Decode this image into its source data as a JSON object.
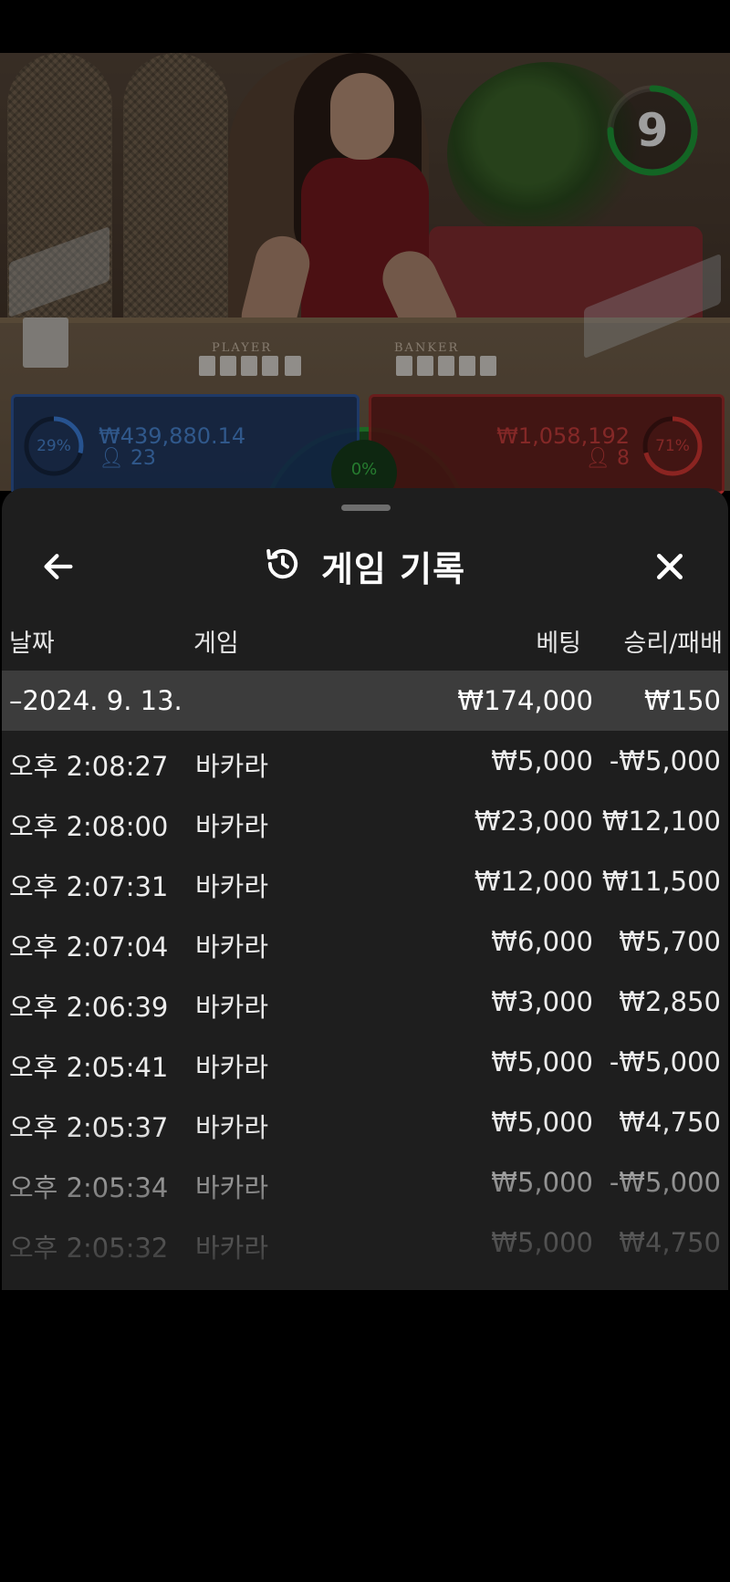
{
  "live": {
    "timer": "9",
    "timer_fraction": 0.75,
    "player_zone_label": "PLAYER",
    "banker_zone_label": "BANKER",
    "player": {
      "percent": "29%",
      "percent_value": 0.29,
      "amount": "₩439,880.14",
      "count": "23"
    },
    "tie": {
      "percent": "0%"
    },
    "banker": {
      "percent": "71%",
      "percent_value": 0.71,
      "amount": "₩1,058,192",
      "count": "8"
    },
    "colors": {
      "player": "#2b5db0",
      "banker": "#b02b2b",
      "tie": "#2ea83a"
    }
  },
  "sheet": {
    "title": "게임 기록",
    "icons": {
      "back": "arrow-left-icon",
      "history": "history-icon",
      "close": "close-icon"
    },
    "columns": {
      "date": "날짜",
      "game": "게임",
      "bet": "베팅",
      "win_loss": "승리/패배"
    },
    "summary": {
      "date": "–2024. 9. 13.",
      "bet": "₩174,000",
      "win_loss": "₩150"
    },
    "rows": [
      {
        "time": "오후 2:08:27",
        "game": "바카라",
        "bet": "₩5,000",
        "win_loss": "-₩5,000"
      },
      {
        "time": "오후 2:08:00",
        "game": "바카라",
        "bet": "₩23,000",
        "win_loss": "₩12,100"
      },
      {
        "time": "오후 2:07:31",
        "game": "바카라",
        "bet": "₩12,000",
        "win_loss": "₩11,500"
      },
      {
        "time": "오후 2:07:04",
        "game": "바카라",
        "bet": "₩6,000",
        "win_loss": "₩5,700"
      },
      {
        "time": "오후 2:06:39",
        "game": "바카라",
        "bet": "₩3,000",
        "win_loss": "₩2,850"
      },
      {
        "time": "오후 2:05:41",
        "game": "바카라",
        "bet": "₩5,000",
        "win_loss": "-₩5,000"
      },
      {
        "time": "오후 2:05:37",
        "game": "바카라",
        "bet": "₩5,000",
        "win_loss": "₩4,750"
      },
      {
        "time": "오후 2:05:34",
        "game": "바카라",
        "bet": "₩5,000",
        "win_loss": "-₩5,000"
      },
      {
        "time": "오후 2:05:32",
        "game": "바카라",
        "bet": "₩5,000",
        "win_loss": "₩4,750"
      }
    ]
  }
}
